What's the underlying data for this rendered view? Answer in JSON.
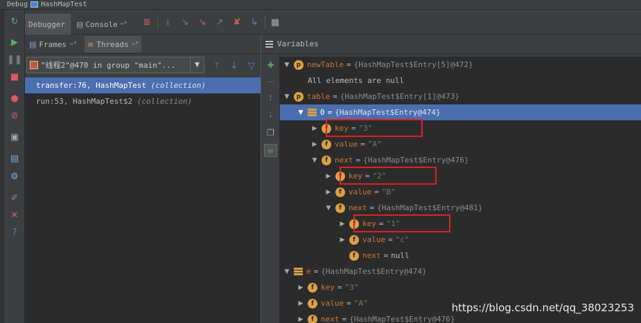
{
  "window": {
    "title_left": "Debug",
    "title_config": "HashMapTest"
  },
  "toolbar": {
    "debugger_tab": "Debugger",
    "console_tab": "Console",
    "console_pin": "→*"
  },
  "frames_panel": {
    "frames_tab": "Frames",
    "threads_tab": "Threads",
    "pin": "→*",
    "thread_combo_value": "\"线程2\"@470 in group \"main\"...",
    "frames": [
      {
        "text": "transfer:76, HashMapTest",
        "tag": "(collection)",
        "selected": true
      },
      {
        "text": "run:53, HashMapTest$2",
        "tag": "(collection)",
        "selected": false
      }
    ]
  },
  "variables_panel": {
    "title": "Variables",
    "rows": [
      {
        "toggle": "▼",
        "icon": "p",
        "name": "newTable",
        "eq": "=",
        "value": "{HashMapTest$Entry[5]@472}",
        "kind": "type"
      },
      {
        "toggle": "",
        "icon": "",
        "name": "",
        "eq": "",
        "value": "All elements are null",
        "kind": "plain"
      },
      {
        "toggle": "▼",
        "icon": "p",
        "name": "table",
        "eq": "=",
        "value": "{HashMapTest$Entry[1]@473}",
        "kind": "type"
      },
      {
        "toggle": "▼",
        "icon": "arr",
        "name": "0",
        "eq": "=",
        "value": "{HashMapTest$Entry@474}",
        "kind": "type",
        "selected": true
      },
      {
        "toggle": "▶",
        "icon": "f",
        "name": "key",
        "eq": "=",
        "value": "\"3\"",
        "kind": "str",
        "boxed": true
      },
      {
        "toggle": "▶",
        "icon": "f",
        "name": "value",
        "eq": "=",
        "value": "\"A\"",
        "kind": "str"
      },
      {
        "toggle": "▼",
        "icon": "f",
        "name": "next",
        "eq": "=",
        "value": "{HashMapTest$Entry@476}",
        "kind": "type"
      },
      {
        "toggle": "▶",
        "icon": "f",
        "name": "key",
        "eq": "=",
        "value": "\"2\"",
        "kind": "str",
        "boxed": true
      },
      {
        "toggle": "▶",
        "icon": "f",
        "name": "value",
        "eq": "=",
        "value": "\"B\"",
        "kind": "str"
      },
      {
        "toggle": "▼",
        "icon": "f",
        "name": "next",
        "eq": "=",
        "value": "{HashMapTest$Entry@481}",
        "kind": "type"
      },
      {
        "toggle": "▶",
        "icon": "f",
        "name": "key",
        "eq": "=",
        "value": "\"1\"",
        "kind": "str",
        "boxed": true
      },
      {
        "toggle": "▶",
        "icon": "f",
        "name": "value",
        "eq": "=",
        "value": "\"c\"",
        "kind": "str"
      },
      {
        "toggle": "",
        "icon": "f",
        "name": "next",
        "eq": "=",
        "value": "null",
        "kind": "plain"
      },
      {
        "toggle": "▼",
        "icon": "arr",
        "name": "e",
        "eq": "=",
        "value": "{HashMapTest$Entry@474}",
        "kind": "type"
      },
      {
        "toggle": "▶",
        "icon": "f",
        "name": "key",
        "eq": "=",
        "value": "\"3\"",
        "kind": "str"
      },
      {
        "toggle": "▶",
        "icon": "f",
        "name": "value",
        "eq": "=",
        "value": "\"A\"",
        "kind": "str"
      },
      {
        "toggle": "▶",
        "icon": "f",
        "name": "next",
        "eq": "=",
        "value": "{HashMapTest$Entry@476}",
        "kind": "type"
      }
    ]
  },
  "watermark": "https://blog.csdn.net/qq_38023253",
  "colors": {
    "selection": "#4b6eaf",
    "field_icon": "#d8a14a",
    "highlight_box": "#e02020"
  }
}
